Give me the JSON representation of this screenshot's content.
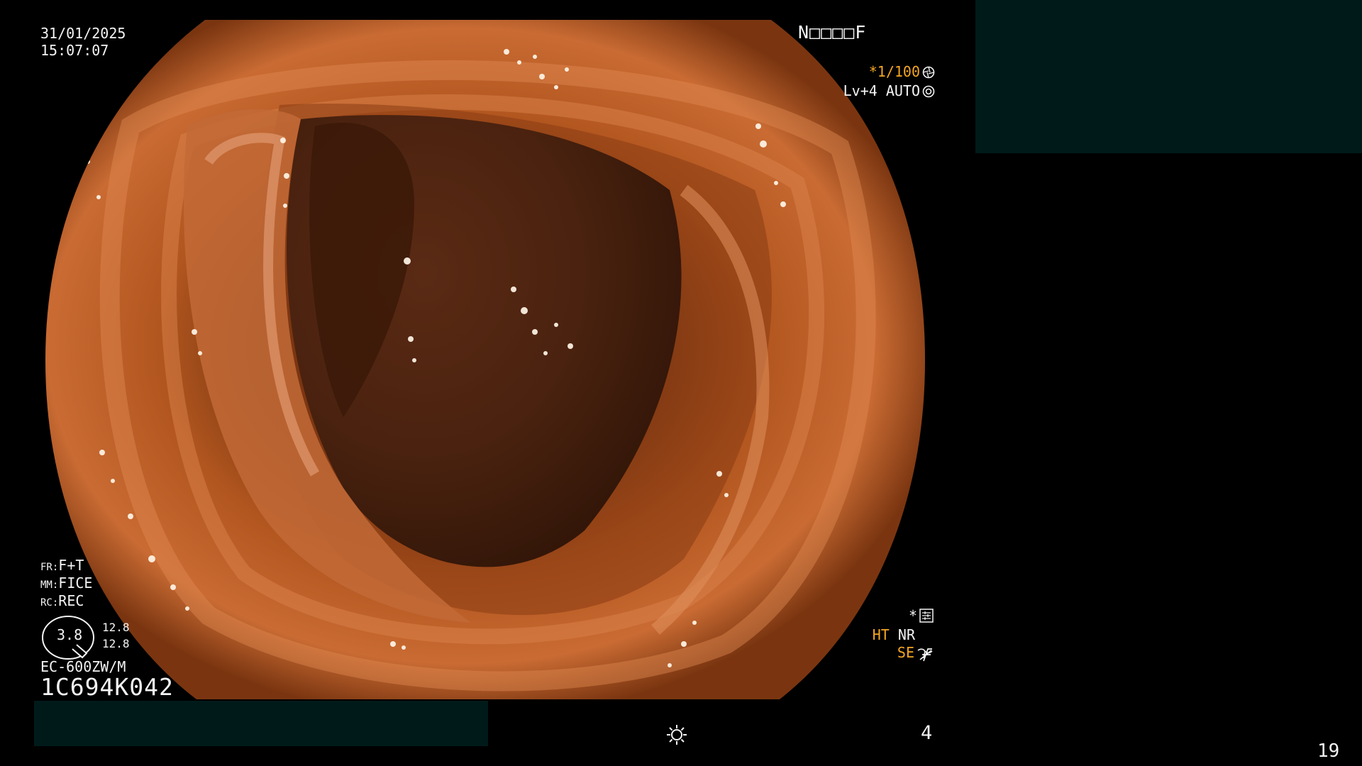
{
  "overlay": {
    "date": "31/01/2025",
    "time": "15:07:07",
    "patient_id": "N□□□□F",
    "shutter": "*1/100",
    "level": "Lv+4 AUTO",
    "fr": {
      "key": "FR:",
      "value": "F+T"
    },
    "mm": {
      "key": "MM:",
      "value": "FICE"
    },
    "rc": {
      "key": "RC:",
      "value": "REC"
    },
    "zoom": "3.8",
    "side_top": "12.8",
    "side_bottom": "12.8",
    "scope_model": "EC-600ZW/M",
    "serial": "1C694K042",
    "star": "*",
    "ht": "HT",
    "nr": "NR",
    "se": "SE",
    "counter": "4",
    "page": "19"
  },
  "icons": [
    "shutter-icon",
    "auto-icon",
    "settings-icon",
    "structure-icon",
    "f-icon",
    "brightness-icon",
    "zoom-gauge-icon"
  ],
  "colors": {
    "overlay_text": "#f4f4f4",
    "accent_text": "#f5a623",
    "redaction": "#001a1a",
    "background": "#000000"
  }
}
